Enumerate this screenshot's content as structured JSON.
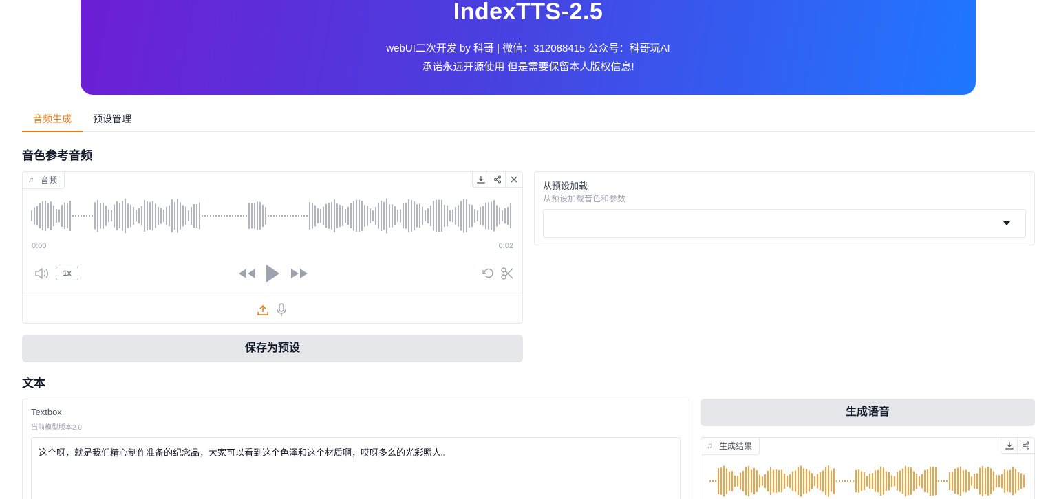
{
  "header": {
    "title": "IndexTTS-2.5",
    "subtitle_line1": "webUI二次开发 by 科哥 | 微信：312088415 公众号：科哥玩AI",
    "subtitle_line2": "承诺永远开源使用 但是需要保留本人版权信息!"
  },
  "tabs": [
    {
      "label": "音频生成",
      "active": true
    },
    {
      "label": "预设管理",
      "active": false
    }
  ],
  "reference_section": {
    "title": "音色参考音频",
    "audio": {
      "label": "音频",
      "time_start": "0:00",
      "time_end": "0:02",
      "speed": "1x",
      "waveform_color": "#9ca3af"
    },
    "save_button": "保存为预设"
  },
  "preset_loader": {
    "label": "从预设加载",
    "info": "从预设加载音色和参数",
    "selected_value": ""
  },
  "text_section": {
    "title": "文本",
    "textbox": {
      "label": "Textbox",
      "info": "当前模型版本2.0",
      "value": "这个呀，就是我们精心制作准备的纪念品，大家可以看到这个色泽和这个材质啊，哎呀多么的光彩照人。"
    }
  },
  "generate": {
    "button": "生成语音",
    "result_label": "生成结果",
    "waveform_color": "#f08a0c"
  },
  "colors": {
    "accent": "#ea7b16",
    "banner_start": "#6d1ed6",
    "banner_end": "#1f78ff"
  }
}
